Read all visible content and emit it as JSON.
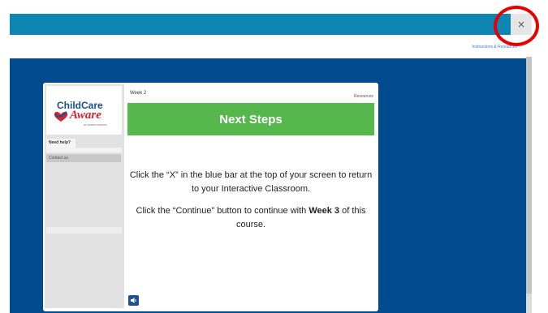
{
  "window": {
    "close_glyph": "×",
    "instructions_link": "Instructions & Resources"
  },
  "logo": {
    "line1": "ChildCare",
    "line2": "Aware",
    "sub": "OF NORTH DAKOTA"
  },
  "sidebar": {
    "help_tab": "Need help?",
    "items": [
      {
        "label": "Contact us"
      }
    ]
  },
  "slide": {
    "week": "Week 2",
    "resources": "Resources",
    "title": "Next Steps",
    "paragraph1": "Click the “X” in the blue bar at the top of your screen to return to your Interactive Classroom.",
    "paragraph2_pre": "Click the “Continue” button to continue with ",
    "paragraph2_bold": "Week 3",
    "paragraph2_post": " of this course."
  },
  "icons": {
    "close": "close-icon",
    "audio": "speaker-icon"
  },
  "colors": {
    "top_bar": "#0e86b3",
    "stage": "#004b8d",
    "banner": "#56b74c",
    "annotation": "#e60000"
  }
}
